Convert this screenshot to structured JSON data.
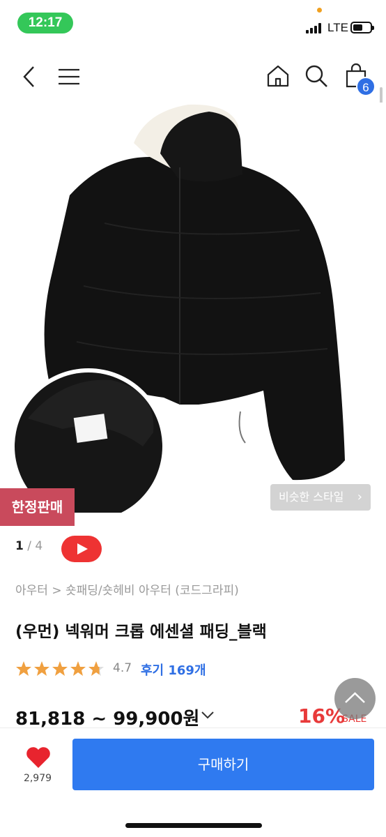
{
  "status_bar": {
    "time": "12:17",
    "network": "LTE"
  },
  "nav": {
    "cart_count": "6"
  },
  "product": {
    "limited_badge": "한정판매",
    "similar_style": "비슷한 스타일",
    "image_index": "1",
    "image_total": "/ 4",
    "breadcrumb": "아우터 > 숏패딩/숏헤비 아우터 (코드그라피)",
    "title": "(우먼) 넥워머 크롭 에센셜 패딩_블랙",
    "rating": "4.7",
    "reviews": "후기 169개",
    "price": "81,818 ~ 99,900원",
    "discount": "16%",
    "sale": "SALE",
    "rating_stars": 4.7
  },
  "bottom": {
    "like_count": "2,979",
    "buy_label": "구매하기"
  },
  "colors": {
    "accent": "#2f7af0",
    "discount": "#e83a3a",
    "badge": "#c94a5c",
    "star": "#f0a040"
  }
}
